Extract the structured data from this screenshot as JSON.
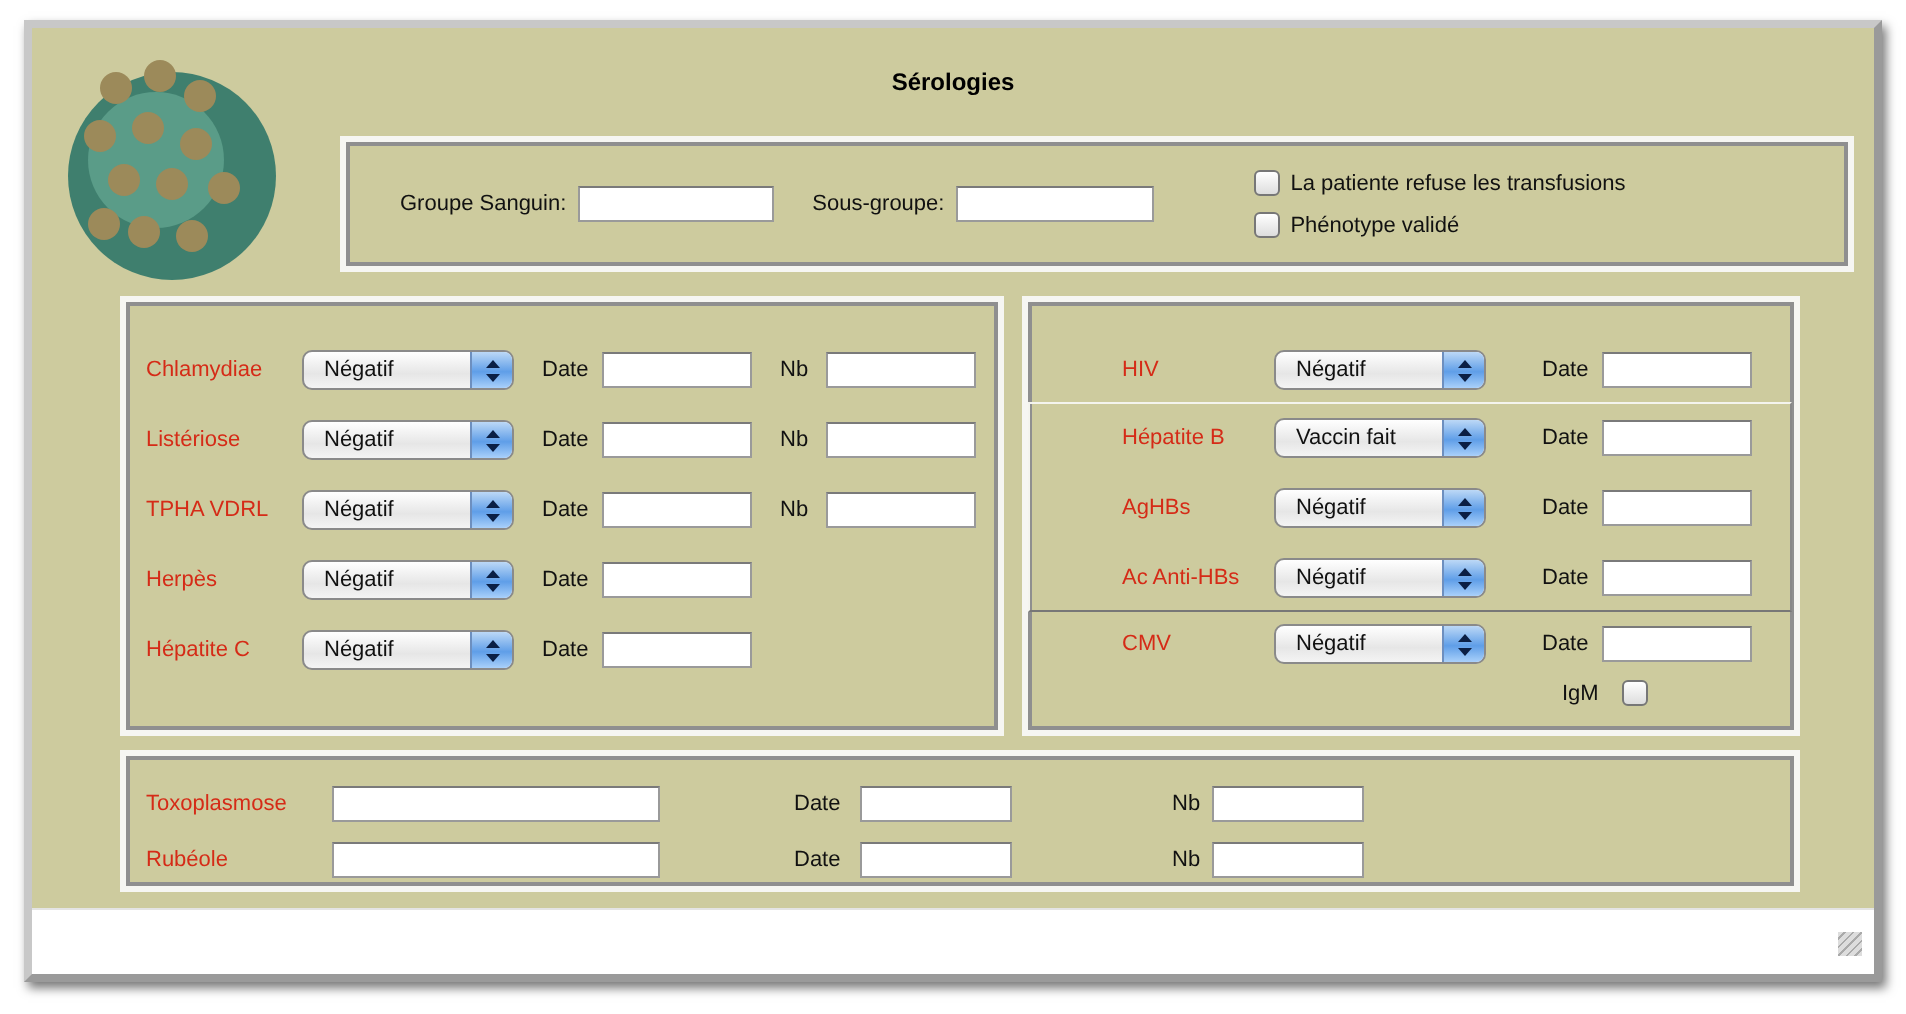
{
  "title": "Sérologies",
  "blood": {
    "group_label": "Groupe Sanguin:",
    "subgroup_label": "Sous-groupe:"
  },
  "options": [
    {
      "label": "La patiente refuse les transfusions",
      "checked": false
    },
    {
      "label": "Phénotype validé",
      "checked": false
    }
  ],
  "left_tests": [
    {
      "name": "Chlamydiae",
      "result": "Négatif",
      "date_label": "Date",
      "nb_label": "Nb"
    },
    {
      "name": "Listériose",
      "result": "Négatif",
      "date_label": "Date",
      "nb_label": "Nb"
    },
    {
      "name": "TPHA VDRL",
      "result": "Négatif",
      "date_label": "Date",
      "nb_label": "Nb"
    },
    {
      "name": "Herpès",
      "result": "Négatif",
      "date_label": "Date"
    },
    {
      "name": "Hépatite C",
      "result": "Négatif",
      "date_label": "Date"
    }
  ],
  "right_groups": [
    {
      "kind": "plain",
      "tests": [
        {
          "name": "HIV",
          "result": "Négatif",
          "date_label": "Date"
        }
      ]
    },
    {
      "kind": "boxed",
      "tests": [
        {
          "name": "Hépatite B",
          "result": "Vaccin fait",
          "date_label": "Date"
        },
        {
          "name": "AgHBs",
          "result": "Négatif",
          "date_label": "Date"
        },
        {
          "name": "Ac Anti-HBs",
          "result": "Négatif",
          "date_label": "Date"
        }
      ]
    },
    {
      "kind": "plain",
      "tests": [
        {
          "name": "CMV",
          "result": "Négatif",
          "date_label": "Date",
          "igm": {
            "label": "IgM",
            "checked": false
          }
        }
      ]
    }
  ],
  "bottom_tests": [
    {
      "name": "Toxoplasmose",
      "date_label": "Date",
      "nb_label": "Nb"
    },
    {
      "name": "Rubéole",
      "date_label": "Date",
      "nb_label": "Nb"
    }
  ]
}
